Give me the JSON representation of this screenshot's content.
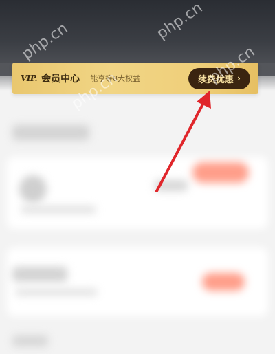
{
  "vip_banner": {
    "logo": "VIP.",
    "title": "会员中心",
    "subtitle": "能享等8大权益",
    "renew_label": "续费优惠",
    "chevron": "›"
  },
  "watermark": "php.cn",
  "colors": {
    "banner_gold": "#efcf7a",
    "button_brown": "#3a2410",
    "button_text": "#f6dfa0",
    "arrow_red": "#e0262b",
    "blurred_pill": "#ff9e8a"
  }
}
